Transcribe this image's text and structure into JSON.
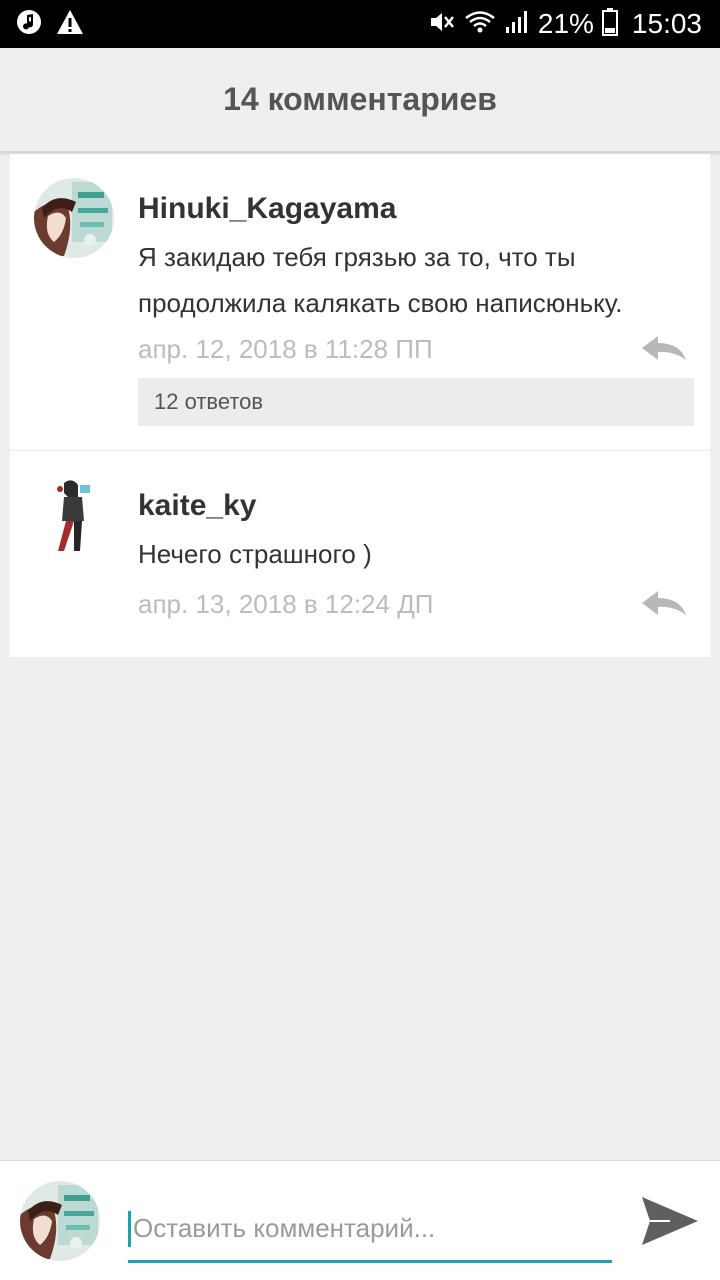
{
  "status_bar": {
    "battery": "21%",
    "time": "15:03",
    "icons": [
      "music-notification-icon",
      "warning-icon",
      "mute-icon",
      "wifi-icon",
      "signal-icon",
      "battery-icon"
    ]
  },
  "header": {
    "title": "14 комментариев"
  },
  "comments": [
    {
      "author": "Hinuki_Kagayama",
      "text": "Я закидаю тебя грязью за то, что ты продолжила калякать свою написюньку.",
      "date": "апр. 12, 2018 в 11:28 ПП",
      "replies_label": "12 ответов"
    },
    {
      "author": "kaite_ky",
      "text": "Нечего страшного )",
      "date": "апр. 13, 2018 в 12:24 ДП"
    }
  ],
  "compose": {
    "placeholder": "Оставить комментарий..."
  },
  "colors": {
    "accent": "#1ba3ad",
    "background": "#efeef1",
    "date_text": "#bcbcbc"
  }
}
